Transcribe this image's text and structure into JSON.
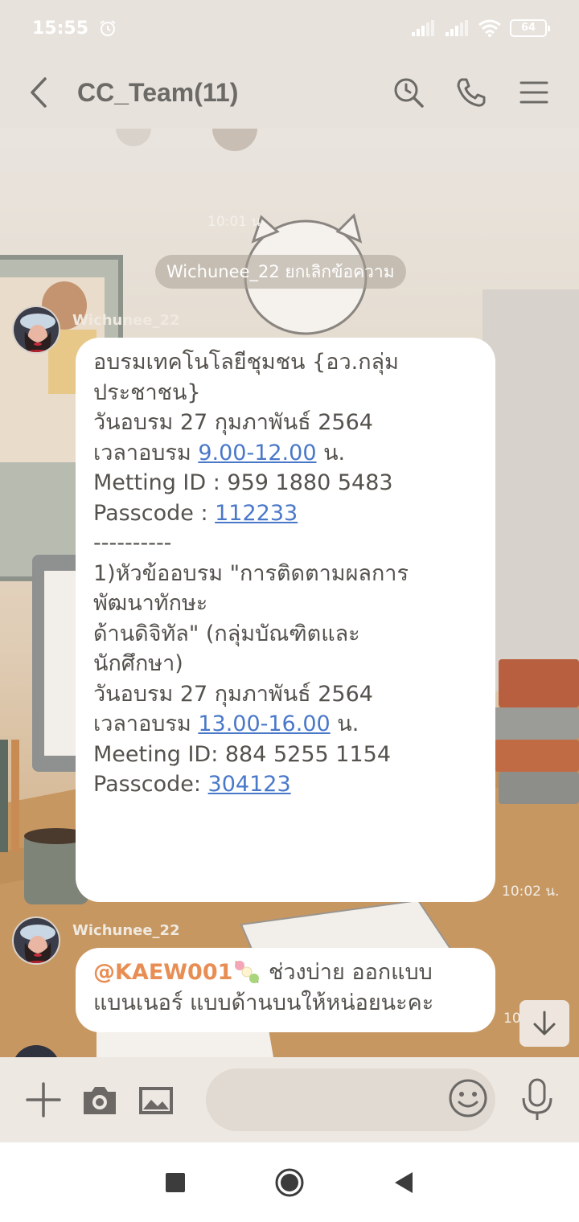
{
  "status_bar": {
    "time": "15:55",
    "battery": "64"
  },
  "header": {
    "title": "CC_Team(11)"
  },
  "chat": {
    "timestamp_top": "10:01 น.",
    "system_notice": "Wichunee_22 ยกเลิกข้อความ",
    "messages": [
      {
        "sender": "Wichunee_22",
        "lines": {
          "l1": "อบรมเทคโนโลยีชุมชน {อว.กลุ่ม",
          "l2": "ประชาชน}",
          "l3": "วันอบรม 27 กุมภาพันธ์ 2564",
          "l4_prefix": "เวลาอบรม ",
          "l4_link": "9.00-12.00",
          "l4_suffix": " น.",
          "l5": "Metting ID : 959 1880 5483",
          "l6_prefix": "Passcode : ",
          "l6_link": "112233",
          "l7": "----------",
          "l8": "1)หัวข้ออบรม \"การติดตามผลการ",
          "l9": "พัฒนาทักษะ",
          "l10": "ด้านดิจิทัล\" (กลุ่มบัณฑิตและ",
          "l11": "นักศึกษา)",
          "l12": "วันอบรม 27 กุมภาพันธ์ 2564",
          "l13_prefix": "เวลาอบรม ",
          "l13_link": "13.00-16.00",
          "l13_suffix": " น.",
          "l14": "Meeting ID: 884 5255 1154",
          "l15_prefix": "Passcode: ",
          "l15_link": "304123"
        },
        "time": "10:02 น."
      },
      {
        "sender": "Wichunee_22",
        "mention": "@KAEW001",
        "text_line1": " ช่วงบ่าย ออกแบบ",
        "text_line2": "แบนเนอร์ แบบด้านบนให้หน่อยนะคะ",
        "time": "10"
      }
    ]
  },
  "icons": {
    "back": "chevron-left-icon",
    "search": "search-icon",
    "call": "phone-icon",
    "menu": "menu-icon",
    "add": "plus-icon",
    "camera": "camera-icon",
    "image": "image-icon",
    "emoji": "emoji-icon",
    "mic": "microphone-icon",
    "scroll_down": "arrow-down-icon"
  },
  "colors": {
    "link": "#4a78c9",
    "mention": "#e88e54",
    "bubble": "#ffffff"
  }
}
